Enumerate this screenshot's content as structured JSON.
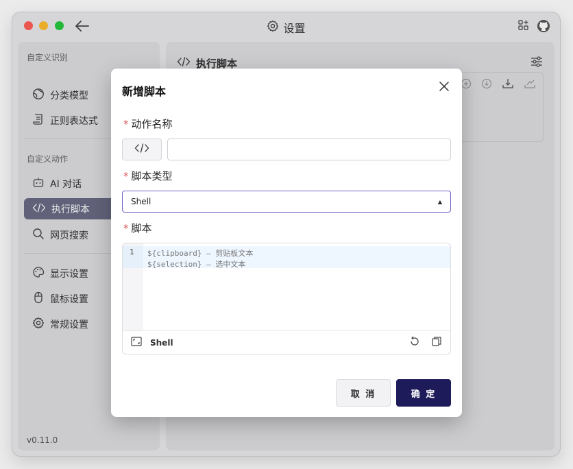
{
  "window": {
    "title": "设置",
    "version": "v0.11.0"
  },
  "sidebar": {
    "section1_label": "自定义识别",
    "section2_label": "自定义动作",
    "items": [
      {
        "label": "分类模型",
        "icon": "globe-icon"
      },
      {
        "label": "正则表达式",
        "icon": "scroll-icon"
      },
      {
        "label": "AI 对话",
        "icon": "robot-icon"
      },
      {
        "label": "执行脚本",
        "icon": "code-icon",
        "active": true
      },
      {
        "label": "网页搜索",
        "icon": "search-icon"
      },
      {
        "label": "显示设置",
        "icon": "palette-icon"
      },
      {
        "label": "鼠标设置",
        "icon": "mouse-icon"
      },
      {
        "label": "常规设置",
        "icon": "gear-icon"
      }
    ]
  },
  "main": {
    "header": "执行脚本"
  },
  "dialog": {
    "title": "新增脚本",
    "name_label": "动作名称",
    "name_value": "",
    "type_label": "脚本类型",
    "type_value": "Shell",
    "script_label": "脚本",
    "editor": {
      "line_number": "1",
      "lines": [
        "${clipboard} – 剪贴板文本",
        "${selection} – 选中文本"
      ],
      "language": "Shell"
    },
    "cancel_label": "取 消",
    "ok_label": "确 定"
  },
  "colors": {
    "accent": "#1d1b5a",
    "select_border": "#6b62c7",
    "required": "#e0575b",
    "active_nav": "#6a6a84"
  }
}
